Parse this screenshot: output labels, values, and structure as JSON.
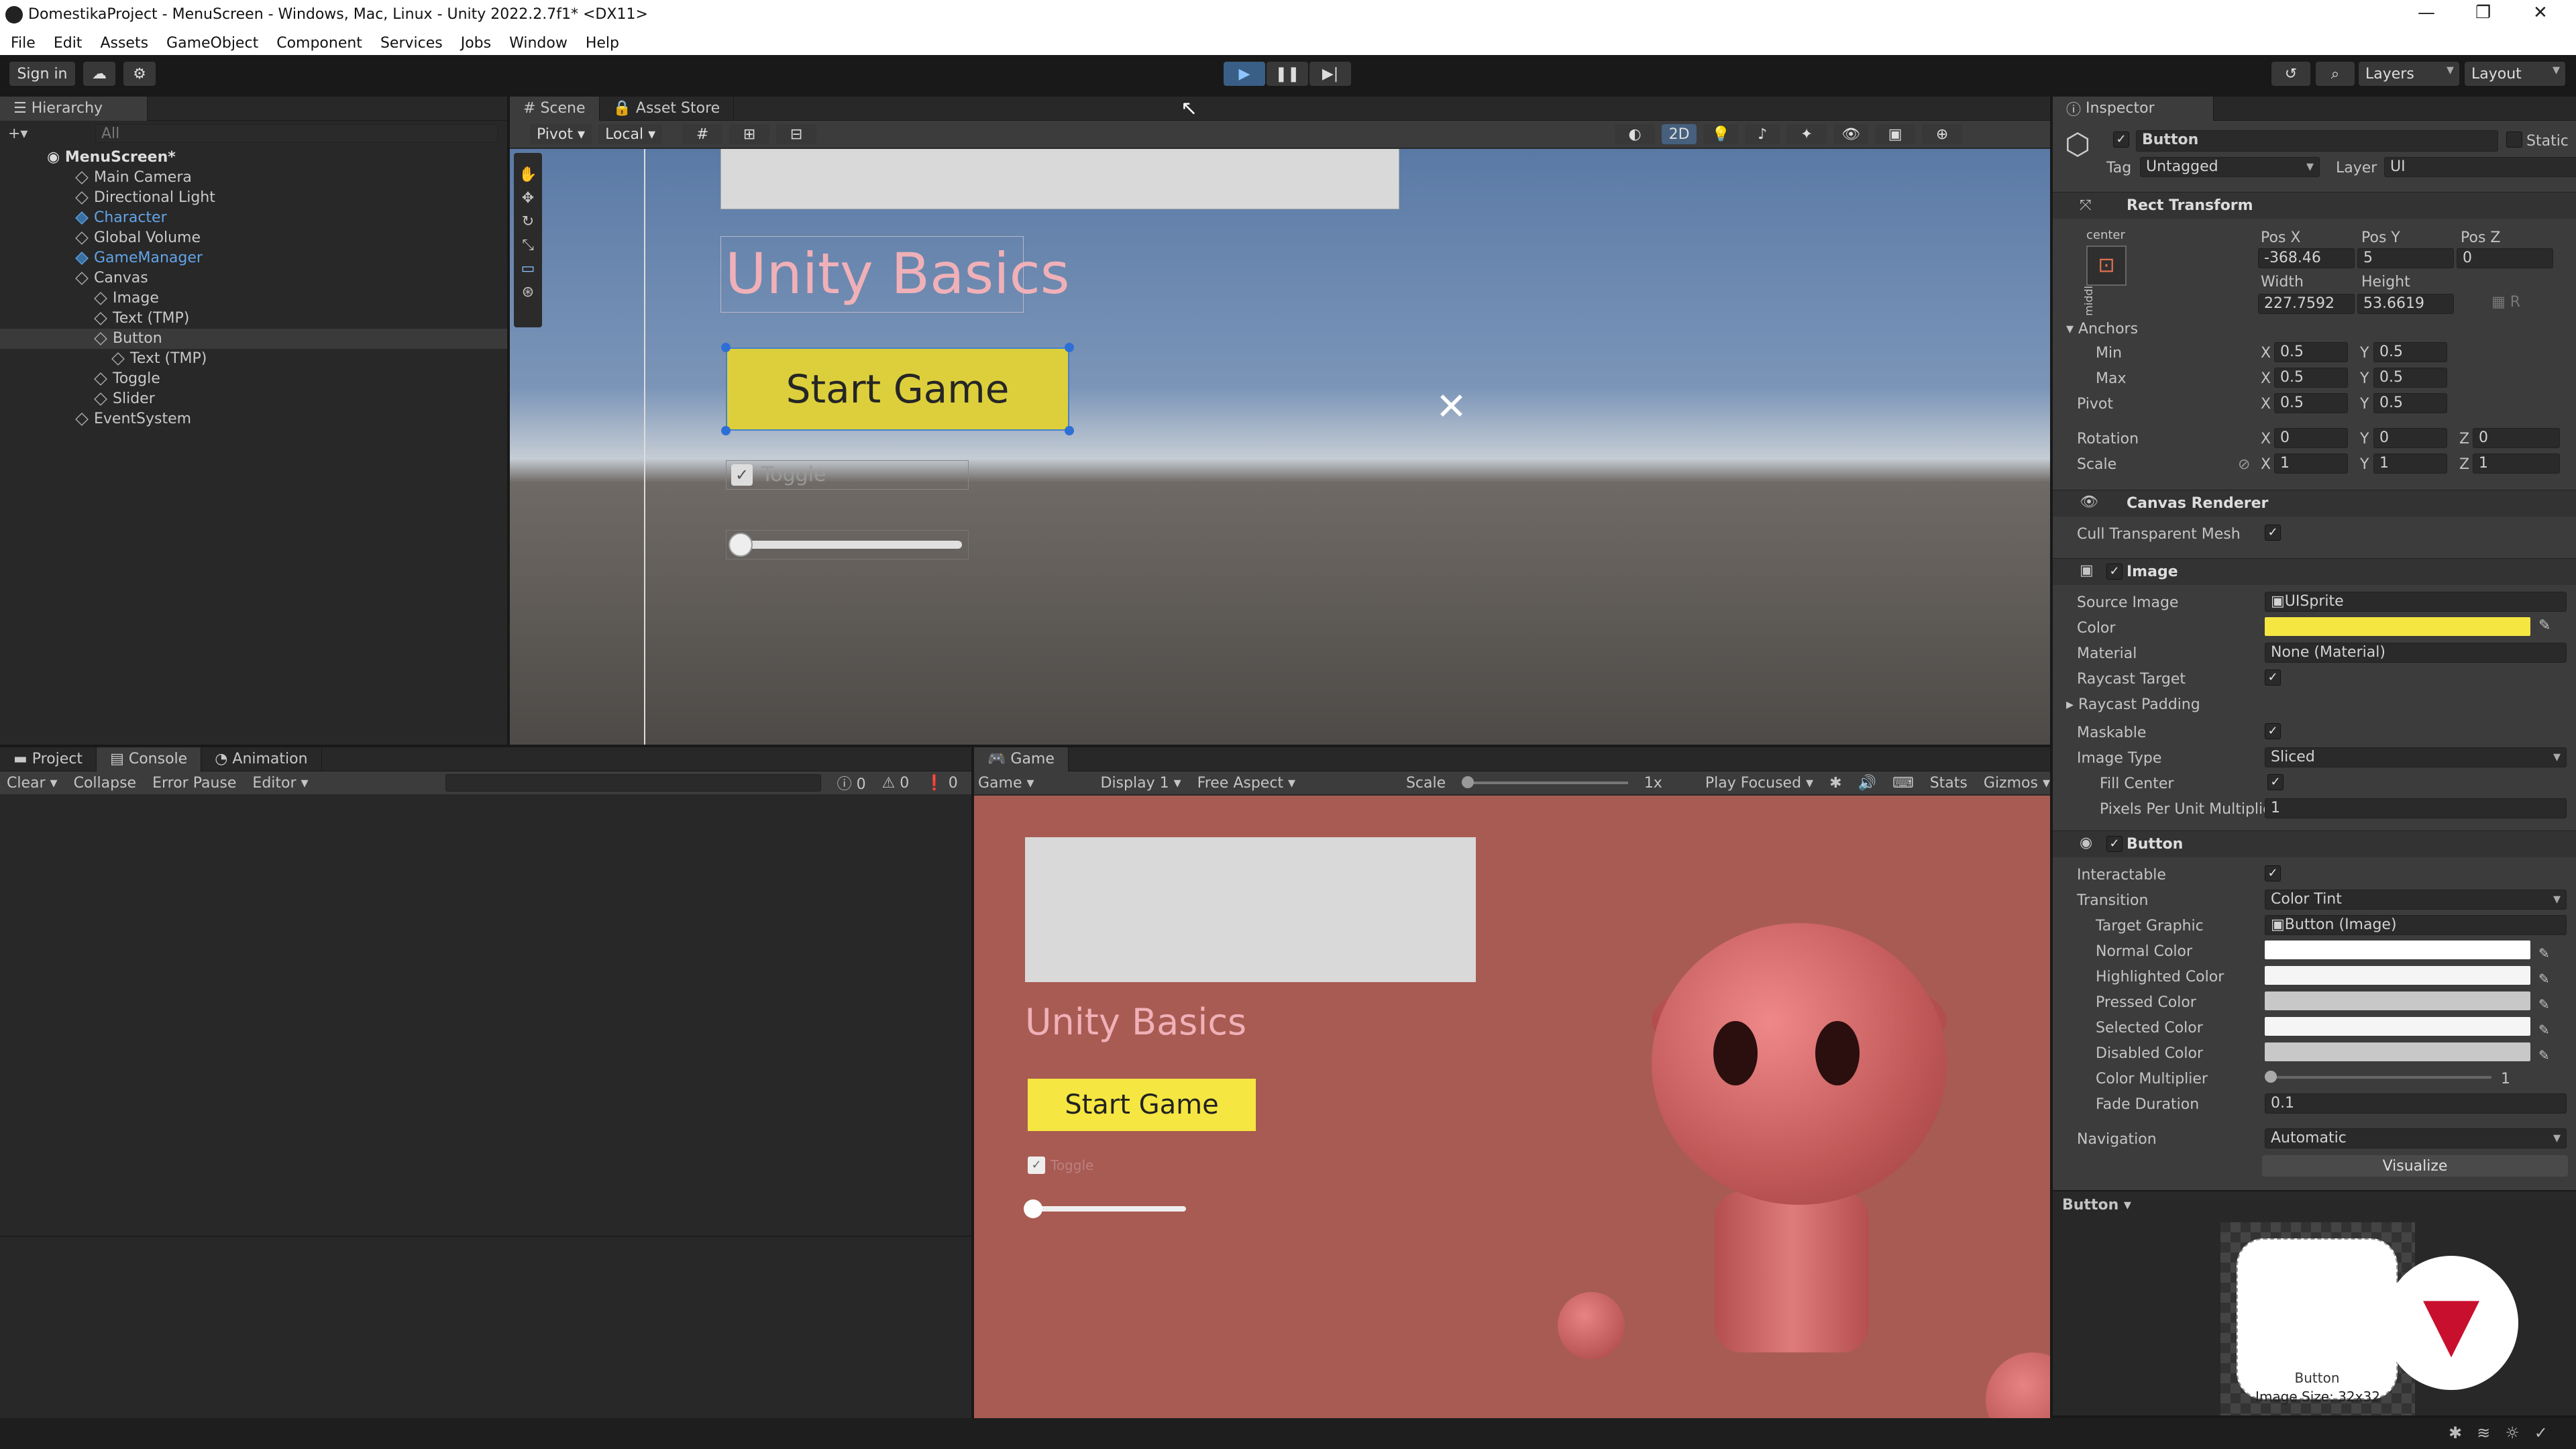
{
  "window": {
    "title": "DomestikaProject - MenuScreen - Windows, Mac, Linux - Unity 2022.2.7f1* <DX11>"
  },
  "menu": [
    "File",
    "Edit",
    "Assets",
    "GameObject",
    "Component",
    "Services",
    "Jobs",
    "Window",
    "Help"
  ],
  "toolbar": {
    "sign_in": "Sign in",
    "layers": "Layers",
    "layout": "Layout"
  },
  "hierarchy": {
    "tab": "Hierarchy",
    "search_placeholder": "All",
    "scene": "MenuScreen*",
    "items": [
      {
        "label": "Main Camera"
      },
      {
        "label": "Directional Light"
      },
      {
        "label": "Character"
      },
      {
        "label": "Global Volume"
      },
      {
        "label": "GameManager"
      },
      {
        "label": "Canvas"
      },
      {
        "label": "Image"
      },
      {
        "label": "Text (TMP)"
      },
      {
        "label": "Button"
      },
      {
        "label": "Text (TMP)"
      },
      {
        "label": "Toggle"
      },
      {
        "label": "Slider"
      },
      {
        "label": "EventSystem"
      }
    ]
  },
  "scene": {
    "tabs": [
      "Scene",
      "Asset Store"
    ],
    "pivot": "Pivot",
    "local": "Local",
    "mode_2d": "2D",
    "title": "Unity Basics",
    "button_text": "Start Game",
    "toggle_label": "Toggle"
  },
  "project": {
    "tabs": [
      "Project",
      "Console",
      "Animation"
    ],
    "clear": "Clear",
    "collapse": "Collapse",
    "error_pause": "Error Pause",
    "editor": "Editor",
    "counts": [
      "0",
      "0",
      "0"
    ]
  },
  "game": {
    "tab": "Game",
    "mode": "Game",
    "display": "Display 1",
    "aspect": "Free Aspect",
    "scale_label": "Scale",
    "scale_value": "1x",
    "play_focused": "Play Focused",
    "stats": "Stats",
    "gizmos": "Gizmos",
    "title": "Unity Basics",
    "button_text": "Start Game",
    "toggle_label": "Toggle"
  },
  "inspector": {
    "tab": "Inspector",
    "object_name": "Button",
    "static": "Static",
    "tag_label": "Tag",
    "tag": "Untagged",
    "layer_label": "Layer",
    "layer": "UI",
    "rect": {
      "title": "Rect Transform",
      "anchor_h": "center",
      "anchor_v": "middle",
      "posx_l": "Pos X",
      "posy_l": "Pos Y",
      "posz_l": "Pos Z",
      "posx": "-368.46",
      "posy": "5",
      "posz": "0",
      "width_l": "Width",
      "height_l": "Height",
      "width": "227.7592",
      "height": "53.6619",
      "anchors": "Anchors",
      "min": "Min",
      "max": "Max",
      "pivot": "Pivot",
      "rotation": "Rotation",
      "scale": "Scale",
      "x": "X",
      "y": "Y",
      "z": "Z",
      "min_x": "0.5",
      "min_y": "0.5",
      "max_x": "0.5",
      "max_y": "0.5",
      "pivot_x": "0.5",
      "pivot_y": "0.5",
      "rot_x": "0",
      "rot_y": "0",
      "rot_z": "0",
      "scale_x": "1",
      "scale_y": "1",
      "scale_z": "1"
    },
    "canvas_renderer": {
      "title": "Canvas Renderer",
      "cull": "Cull Transparent Mesh"
    },
    "image": {
      "title": "Image",
      "source_l": "Source Image",
      "source": "UISprite",
      "color_l": "Color",
      "material_l": "Material",
      "material": "None (Material)",
      "raycast_target": "Raycast Target",
      "raycast_padding": "Raycast Padding",
      "maskable": "Maskable",
      "image_type_l": "Image Type",
      "image_type": "Sliced",
      "fill_center": "Fill Center",
      "ppu_l": "Pixels Per Unit Multiplie",
      "ppu": "1"
    },
    "button": {
      "title": "Button",
      "interactable": "Interactable",
      "transition_l": "Transition",
      "transition": "Color Tint",
      "target_l": "Target Graphic",
      "target": "Button (Image)",
      "normal": "Normal Color",
      "highlighted": "Highlighted Color",
      "pressed": "Pressed Color",
      "selected": "Selected Color",
      "disabled": "Disabled Color",
      "multiplier_l": "Color Multiplier",
      "multiplier": "1",
      "fade_l": "Fade Duration",
      "fade": "0.1",
      "navigation_l": "Navigation",
      "navigation": "Automatic",
      "visualize": "Visualize"
    },
    "preview": {
      "title": "Button",
      "caption": "Button",
      "size": "Image Size: 32x32"
    }
  },
  "colors": {
    "button_yellow": "#f5e642",
    "game_bg": "#a85b52",
    "title_pink": "#f0b0b8",
    "scene_sky": "#5a7aa6"
  }
}
